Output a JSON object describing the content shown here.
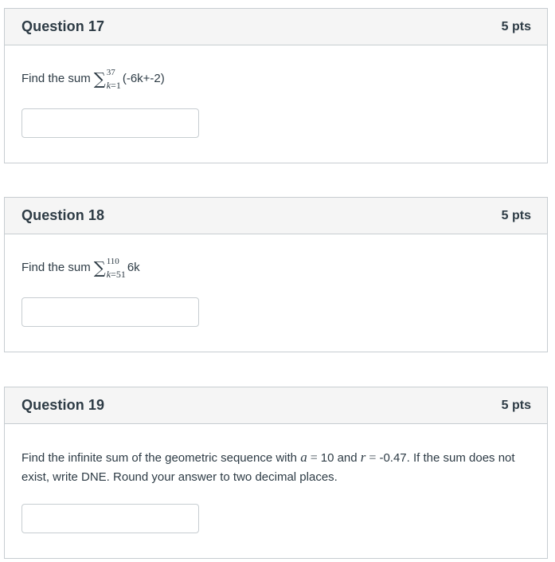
{
  "questions": [
    {
      "title": "Question 17",
      "points": "5 pts",
      "prompt_text": "Find the sum",
      "sigma_upper": "37",
      "sigma_lower_var": "k",
      "sigma_lower_rest": "=1",
      "summand": "(-6k+-2)",
      "answer_value": ""
    },
    {
      "title": "Question 18",
      "points": "5 pts",
      "prompt_text": "Find the sum",
      "sigma_upper": "110",
      "sigma_lower_var": "k",
      "sigma_lower_rest": "=51",
      "summand": "6k",
      "answer_value": ""
    },
    {
      "title": "Question 19",
      "points": "5 pts",
      "prompt_part1": "Find the infinite sum of the geometric sequence with",
      "var_a": "a",
      "eq1": "=",
      "val_a": "10 and",
      "var_r": "r",
      "eq2": "=",
      "prompt_part2": "-0.47. If the sum does not exist, write DNE. Round your answer to two decimal places.",
      "answer_value": ""
    }
  ]
}
